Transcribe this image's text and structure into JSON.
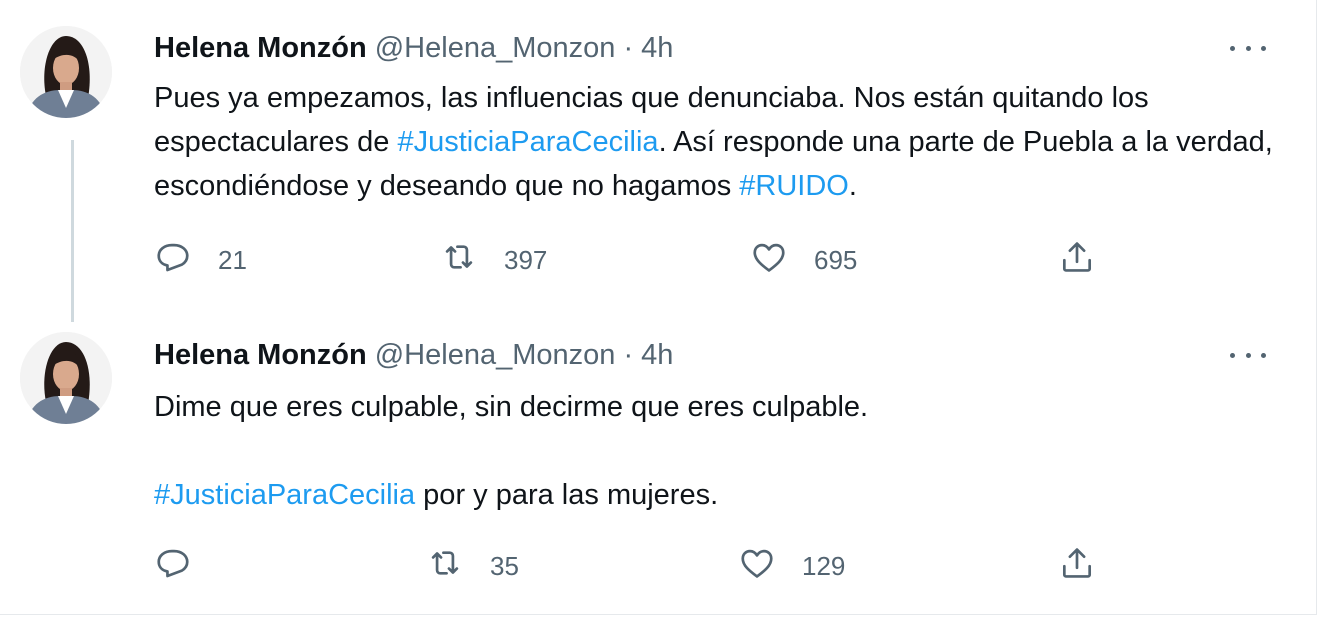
{
  "tweets": [
    {
      "author_name": "Helena Monzón",
      "handle": "@Helena_Monzon",
      "separator": "·",
      "time": "4h",
      "body": {
        "t1": "Pues ya empezamos, las influencias que denunciaba. Nos están quitando los espectaculares de ",
        "h1": "#JusticiaParaCecilia",
        "t2": ". Así responde una parte de Puebla a la verdad, escondiéndose y deseando que no hagamos ",
        "h2": "#RUIDO",
        "t3": "."
      },
      "replies": "21",
      "retweets": "397",
      "likes": "695"
    },
    {
      "author_name": "Helena Monzón",
      "handle": "@Helena_Monzon",
      "separator": "·",
      "time": "4h",
      "body": {
        "p1": "Dime que eres culpable, sin decirme que eres culpable.",
        "h1": "#JusticiaParaCecilia",
        "t2": " por y para las mujeres."
      },
      "replies": "",
      "retweets": "35",
      "likes": "129"
    }
  ],
  "icons": {
    "reply": "reply-icon",
    "retweet": "retweet-icon",
    "like": "heart-icon",
    "share": "share-icon",
    "more": "more-icon"
  },
  "colors": {
    "text": "#0f1419",
    "secondary": "#536471",
    "hashtag": "#1d9bf0",
    "thread_line": "#cfd9de"
  }
}
